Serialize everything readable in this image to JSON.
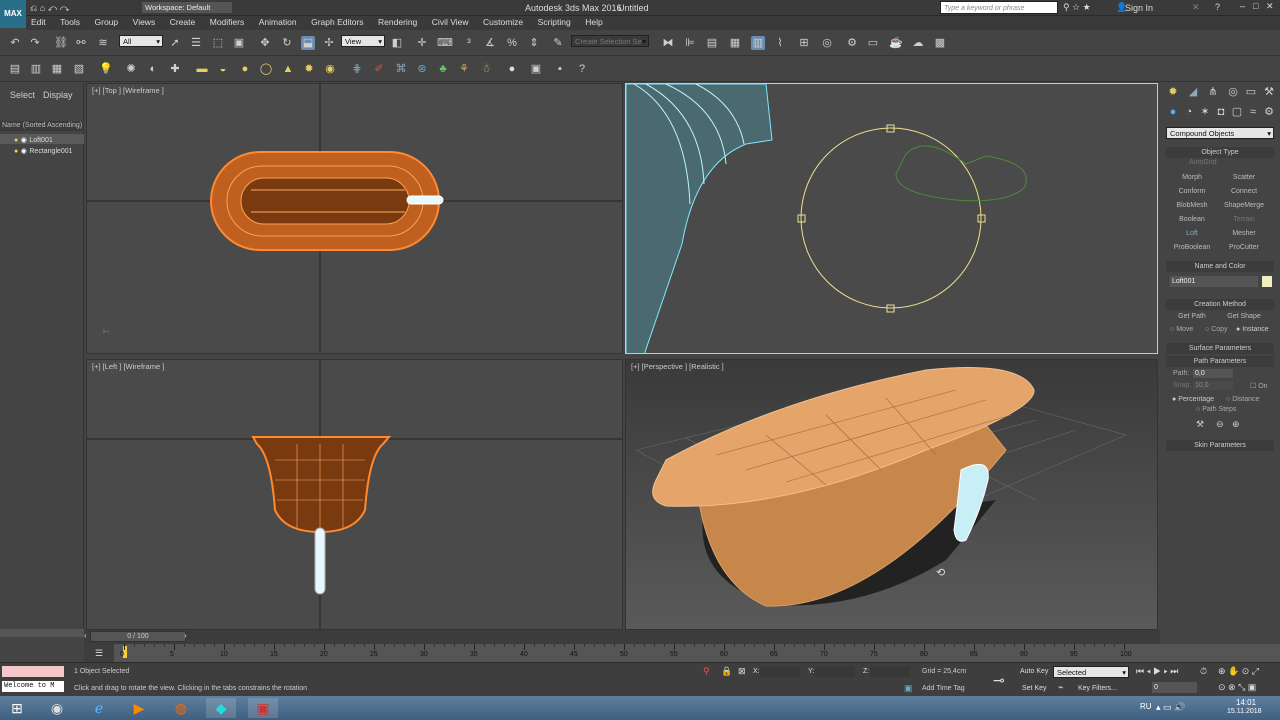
{
  "title": {
    "app": "Autodesk 3ds Max 2016",
    "doc": "Untitled",
    "workspace": "Workspace: Default",
    "search_placeholder": "Type a keyword or phrase",
    "sign_in": "Sign In",
    "logo": "MAX"
  },
  "menu": [
    "Edit",
    "Tools",
    "Group",
    "Views",
    "Create",
    "Modifiers",
    "Animation",
    "Graph Editors",
    "Rendering",
    "Civil View",
    "Customize",
    "Scripting",
    "Help"
  ],
  "toolbar": {
    "filter": "All",
    "refcoord": "View",
    "selection_set": "Create Selection Se"
  },
  "scene_explorer": {
    "tabs": [
      "Select",
      "Display"
    ],
    "header": "Name (Sorted Ascending)",
    "items": [
      "Loft001",
      "Rectangle001"
    ]
  },
  "viewports": {
    "top": "[+] [Top ] [Wireframe ]",
    "left": "[+] [Left ] [Wireframe ]",
    "persp": "[+] [Perspective ] [Realistic ]"
  },
  "command_panel": {
    "category": "Compound Objects",
    "object_type_header": "Object Type",
    "autogrid": "AutoGrid",
    "object_types": [
      "Morph",
      "Scatter",
      "Conform",
      "Connect",
      "BlobMesh",
      "ShapeMerge",
      "Boolean",
      "Terrain",
      "Loft",
      "Mesher",
      "ProBoolean",
      "ProCutter"
    ],
    "name_color_header": "Name and Color",
    "object_name": "Loft001",
    "creation_header": "Creation Method",
    "get_path": "Get Path",
    "get_shape": "Get Shape",
    "radio": [
      "Move",
      "Copy",
      "Instance"
    ],
    "surface_header": "Surface Parameters",
    "path_header": "Path Parameters",
    "path_label": "Path:",
    "path_value": "0,0",
    "snap_label": "Snap:",
    "snap_value": "10,0",
    "on_label": "On",
    "percentage": "Percentage",
    "distance": "Distance",
    "path_steps": "Path Steps",
    "skin_header": "Skin Parameters"
  },
  "timeline": {
    "frame": "0 / 100",
    "ticks": [
      "0",
      "5",
      "10",
      "15",
      "20",
      "25",
      "30",
      "35",
      "40",
      "45",
      "50",
      "55",
      "60",
      "65",
      "70",
      "75",
      "80",
      "85",
      "90",
      "95",
      "100"
    ]
  },
  "status": {
    "maxscript": "Welcome to M",
    "selected": "1 Object Selected",
    "prompt": "Click and drag to rotate the view.  Clicking in the tabs constrains the rotation",
    "x": "X:",
    "y": "Y:",
    "z": "Z:",
    "grid": "Grid = 25,4cm",
    "add_time_tag": "Add Time Tag",
    "auto_key": "Auto Key",
    "set_key": "Set Key",
    "key_mode": "Selected",
    "key_filters": "Key Filters...",
    "frame_field": "0"
  },
  "taskbar": {
    "lang": "RU",
    "time": "14:01",
    "date": "15.11.2018"
  }
}
